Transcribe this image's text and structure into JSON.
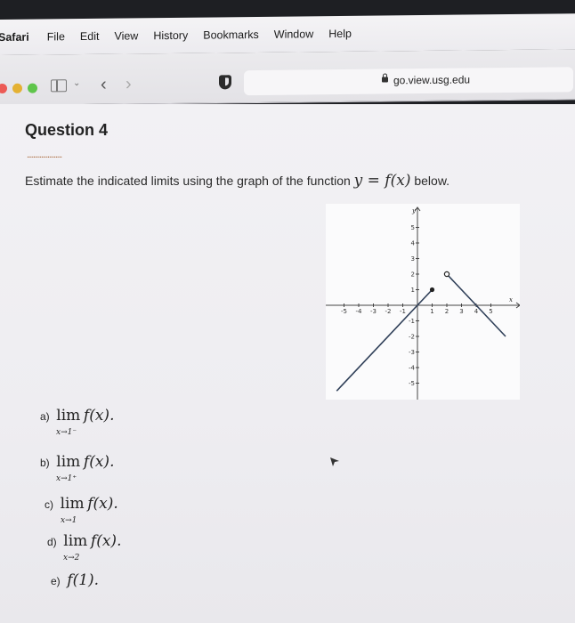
{
  "menubar": {
    "items": [
      "Safari",
      "File",
      "Edit",
      "View",
      "History",
      "Bookmarks",
      "Window",
      "Help"
    ]
  },
  "toolbar": {
    "window_controls": [
      "close",
      "minimize",
      "zoom"
    ],
    "url": "go.view.usg.edu",
    "colors": {
      "close": "#ec5b56",
      "minimize": "#e4b133",
      "zoom": "#5fc54b"
    }
  },
  "question": {
    "title": "Question 4",
    "separator": "......................",
    "prompt_text": "Estimate the indicated limits using the graph of the function",
    "prompt_math": "y = f(x)",
    "prompt_suffix": "below."
  },
  "graph": {
    "x_axis_label": "x",
    "y_axis_label": "y",
    "x_ticks": [
      -5,
      -4,
      -3,
      -2,
      -1,
      1,
      2,
      3,
      4,
      5
    ],
    "y_ticks": [
      -5,
      -4,
      -3,
      -2,
      -1,
      1,
      2,
      3,
      4,
      5
    ],
    "xlim": [
      -5.5,
      6
    ],
    "ylim": [
      -6,
      6
    ],
    "pieces": [
      {
        "points": [
          [
            -5.5,
            -5.5
          ],
          [
            1,
            1
          ]
        ],
        "end": "closed"
      },
      {
        "points": [
          [
            2,
            2
          ],
          [
            6,
            -2
          ]
        ],
        "start": "open"
      }
    ]
  },
  "parts": [
    {
      "label": "a)",
      "op": "lim",
      "sub": "x→1⁻",
      "expr": "f(x)."
    },
    {
      "label": "b)",
      "op": "lim",
      "sub": "x→1⁺",
      "expr": "f(x)."
    },
    {
      "label": "c)",
      "op": "lim",
      "sub": "x→1",
      "expr": "f(x)."
    },
    {
      "label": "d)",
      "op": "lim",
      "sub": "x→2",
      "expr": "f(x)."
    },
    {
      "label": "e)",
      "op": "",
      "sub": "",
      "expr": "f(1)."
    }
  ]
}
